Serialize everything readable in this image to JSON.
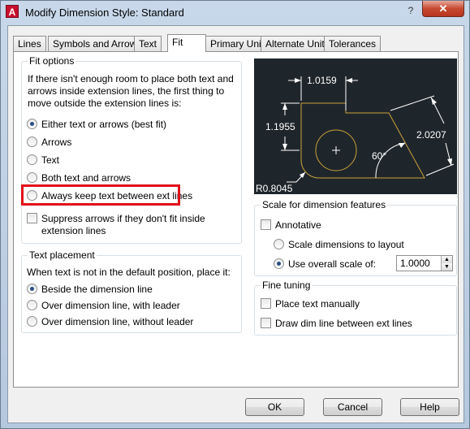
{
  "window": {
    "title": "Modify Dimension Style: Standard",
    "app_icon_letter": "A",
    "help_glyph": "?",
    "close_glyph": "✕"
  },
  "tabs": [
    {
      "label": "Lines",
      "active": false
    },
    {
      "label": "Symbols and Arrows",
      "active": false
    },
    {
      "label": "Text",
      "active": false
    },
    {
      "label": "Fit",
      "active": true
    },
    {
      "label": "Primary Units",
      "active": false
    },
    {
      "label": "Alternate Units",
      "active": false
    },
    {
      "label": "Tolerances",
      "active": false
    }
  ],
  "fit_options": {
    "legend": "Fit options",
    "description": [
      "If there isn't enough room to place both text and",
      "arrows inside extension lines, the first thing to",
      "move outside the extension lines is:"
    ],
    "radios": [
      {
        "label": "Either text or arrows (best fit)",
        "selected": true
      },
      {
        "label": "Arrows",
        "selected": false
      },
      {
        "label": "Text",
        "selected": false
      },
      {
        "label": "Both text and arrows",
        "selected": false
      },
      {
        "label": "Always keep text between ext lines",
        "selected": false
      }
    ],
    "suppress": {
      "label_line1": "Suppress arrows if they don't fit inside",
      "label_line2": "extension lines",
      "checked": false
    }
  },
  "text_placement": {
    "legend": "Text placement",
    "description": "When text is not in the default position, place it:",
    "radios": [
      {
        "label": "Beside the dimension line",
        "selected": true
      },
      {
        "label": "Over dimension line, with leader",
        "selected": false
      },
      {
        "label": "Over dimension line, without leader",
        "selected": false
      }
    ]
  },
  "preview": {
    "dim_top": "1.0159",
    "dim_left": "1.1955",
    "dim_right": "2.0207",
    "dim_angle": "60°",
    "dim_radius": "R0.8045",
    "colors": {
      "background": "#1f262b",
      "geometry": "#c8a23a",
      "dimensions": "#ffffff"
    }
  },
  "scale": {
    "legend": "Scale for dimension features",
    "annotative": {
      "label": "Annotative",
      "checked": false
    },
    "layout": {
      "label": "Scale dimensions to layout",
      "selected": false
    },
    "overall": {
      "label": "Use overall scale of:",
      "selected": true
    },
    "overall_value": "1.0000"
  },
  "fine_tuning": {
    "legend": "Fine tuning",
    "place_manually": {
      "label": "Place text manually",
      "checked": false
    },
    "draw_dim_line": {
      "label": "Draw dim line between ext lines",
      "checked": false
    }
  },
  "buttons": {
    "ok": "OK",
    "cancel": "Cancel",
    "help": "Help"
  },
  "colors": {
    "highlight_box": "#e0101a",
    "close_button": "#c74a32",
    "radio_dot": "#2a4e84"
  }
}
